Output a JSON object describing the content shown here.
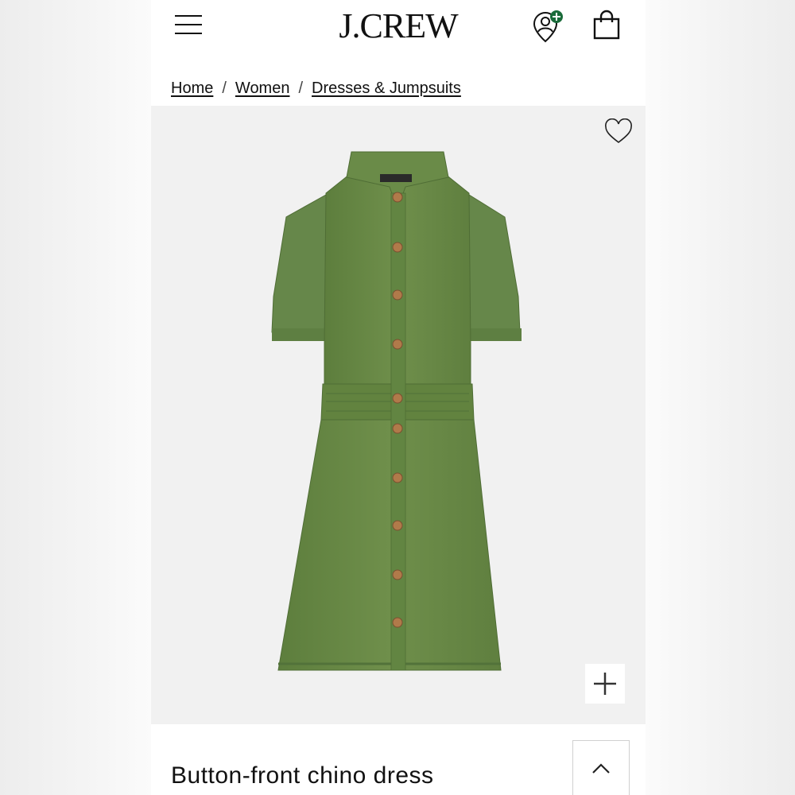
{
  "header": {
    "logo_text": "J.CREW",
    "menu_icon": "hamburger-menu-icon",
    "account_icon": "account-location-icon",
    "account_badge_color": "#1a6b3a",
    "bag_icon": "shopping-bag-icon"
  },
  "breadcrumb": {
    "items": [
      {
        "label": "Home"
      },
      {
        "label": "Women"
      },
      {
        "label": "Dresses & Jumpsuits"
      }
    ],
    "separator": "/"
  },
  "gallery": {
    "wishlist_icon": "heart-outline-icon",
    "zoom_icon": "plus-icon",
    "dress_color": "#6b8c47"
  },
  "product": {
    "title": "Button-front chino dress",
    "collapse_icon": "chevron-up-icon"
  }
}
